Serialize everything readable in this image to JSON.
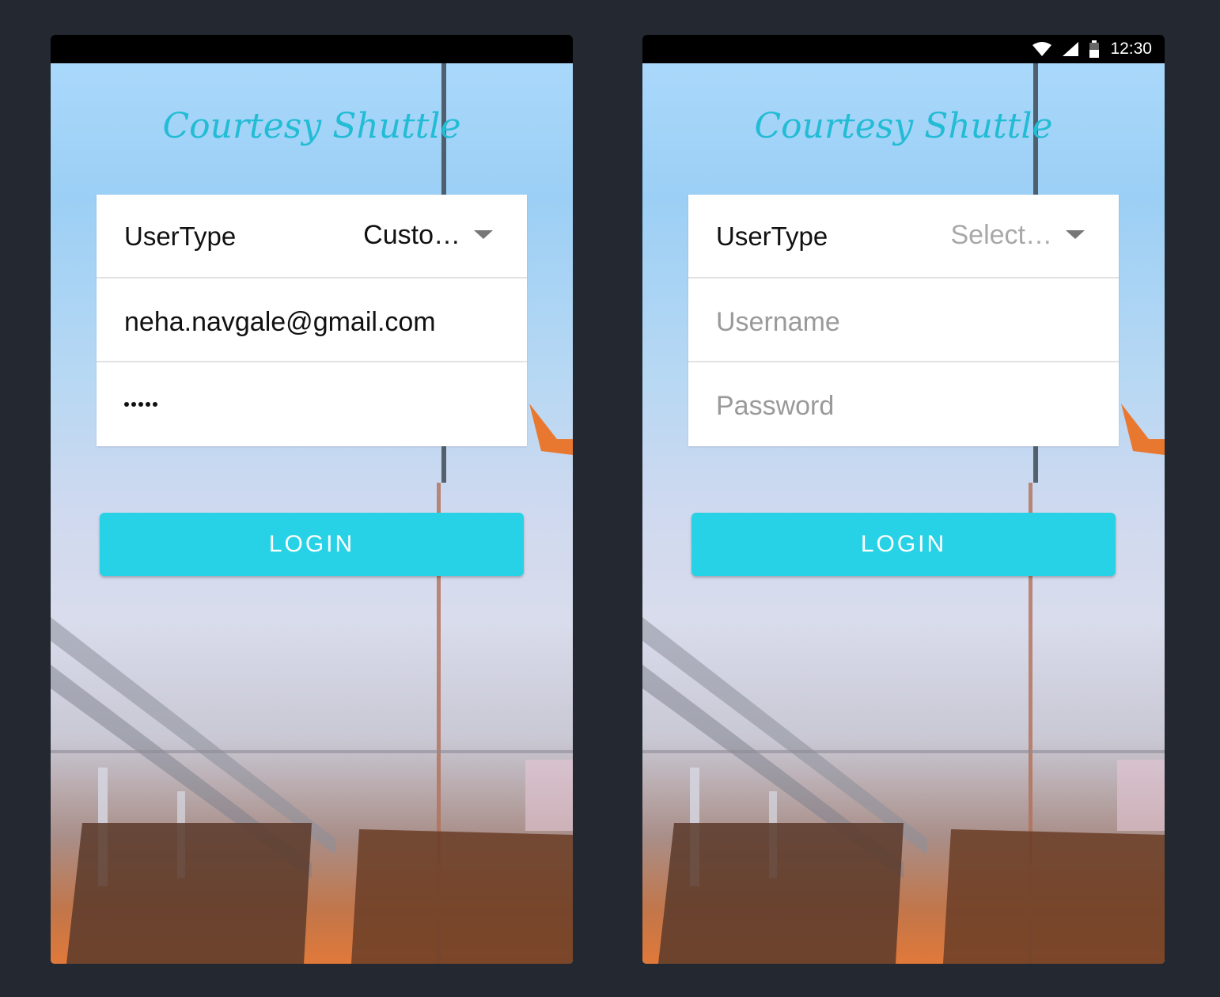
{
  "screens": [
    {
      "brand": "Courtesy Shuttle",
      "user_type_label": "UserType",
      "user_type_value": "Custo…",
      "user_type_is_placeholder": false,
      "username_value": "neha.navgale@gmail.com",
      "password_masked": true,
      "password_dot_count": 5,
      "login_label": "LOGIN"
    },
    {
      "status_time": "12:30",
      "brand": "Courtesy Shuttle",
      "user_type_label": "UserType",
      "user_type_value": "Select…",
      "user_type_is_placeholder": true,
      "username_placeholder": "Username",
      "password_placeholder": "Password",
      "login_label": "LOGIN"
    }
  ],
  "colors": {
    "accent": "#27d2e6",
    "brand_text": "#22bcd4",
    "page_background": "#232831"
  }
}
